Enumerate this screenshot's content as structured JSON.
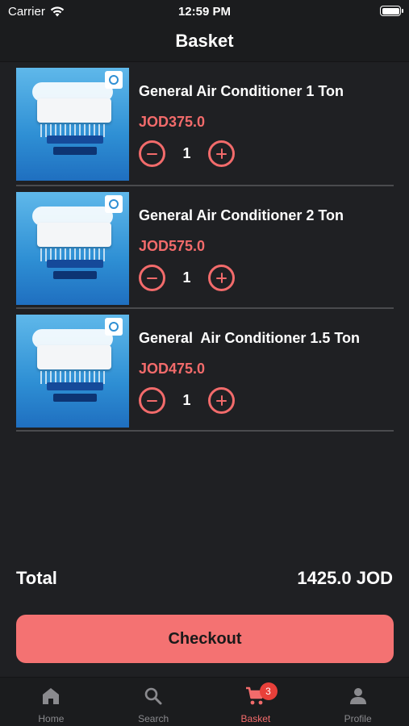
{
  "status_bar": {
    "carrier": "Carrier",
    "time": "12:59 PM"
  },
  "nav": {
    "title": "Basket"
  },
  "items": [
    {
      "name": "General Air Conditioner 1 Ton",
      "price": "JOD375.0",
      "quantity": "1"
    },
    {
      "name": "General Air Conditioner 2 Ton",
      "price": "JOD575.0",
      "quantity": "1"
    },
    {
      "name": "General  Air Conditioner 1.5 Ton",
      "price": "JOD475.0",
      "quantity": "1"
    }
  ],
  "total": {
    "label": "Total",
    "value": "1425.0 JOD"
  },
  "checkout": {
    "label": "Checkout"
  },
  "tabs": [
    {
      "label": "Home",
      "icon": "home-icon"
    },
    {
      "label": "Search",
      "icon": "search-icon"
    },
    {
      "label": "Basket",
      "icon": "cart-icon",
      "badge": "3"
    },
    {
      "label": "Profile",
      "icon": "person-icon"
    }
  ],
  "colors": {
    "accent": "#f26b6b",
    "button": "#f47272",
    "background": "#1f2023",
    "badge": "#e8403a"
  }
}
